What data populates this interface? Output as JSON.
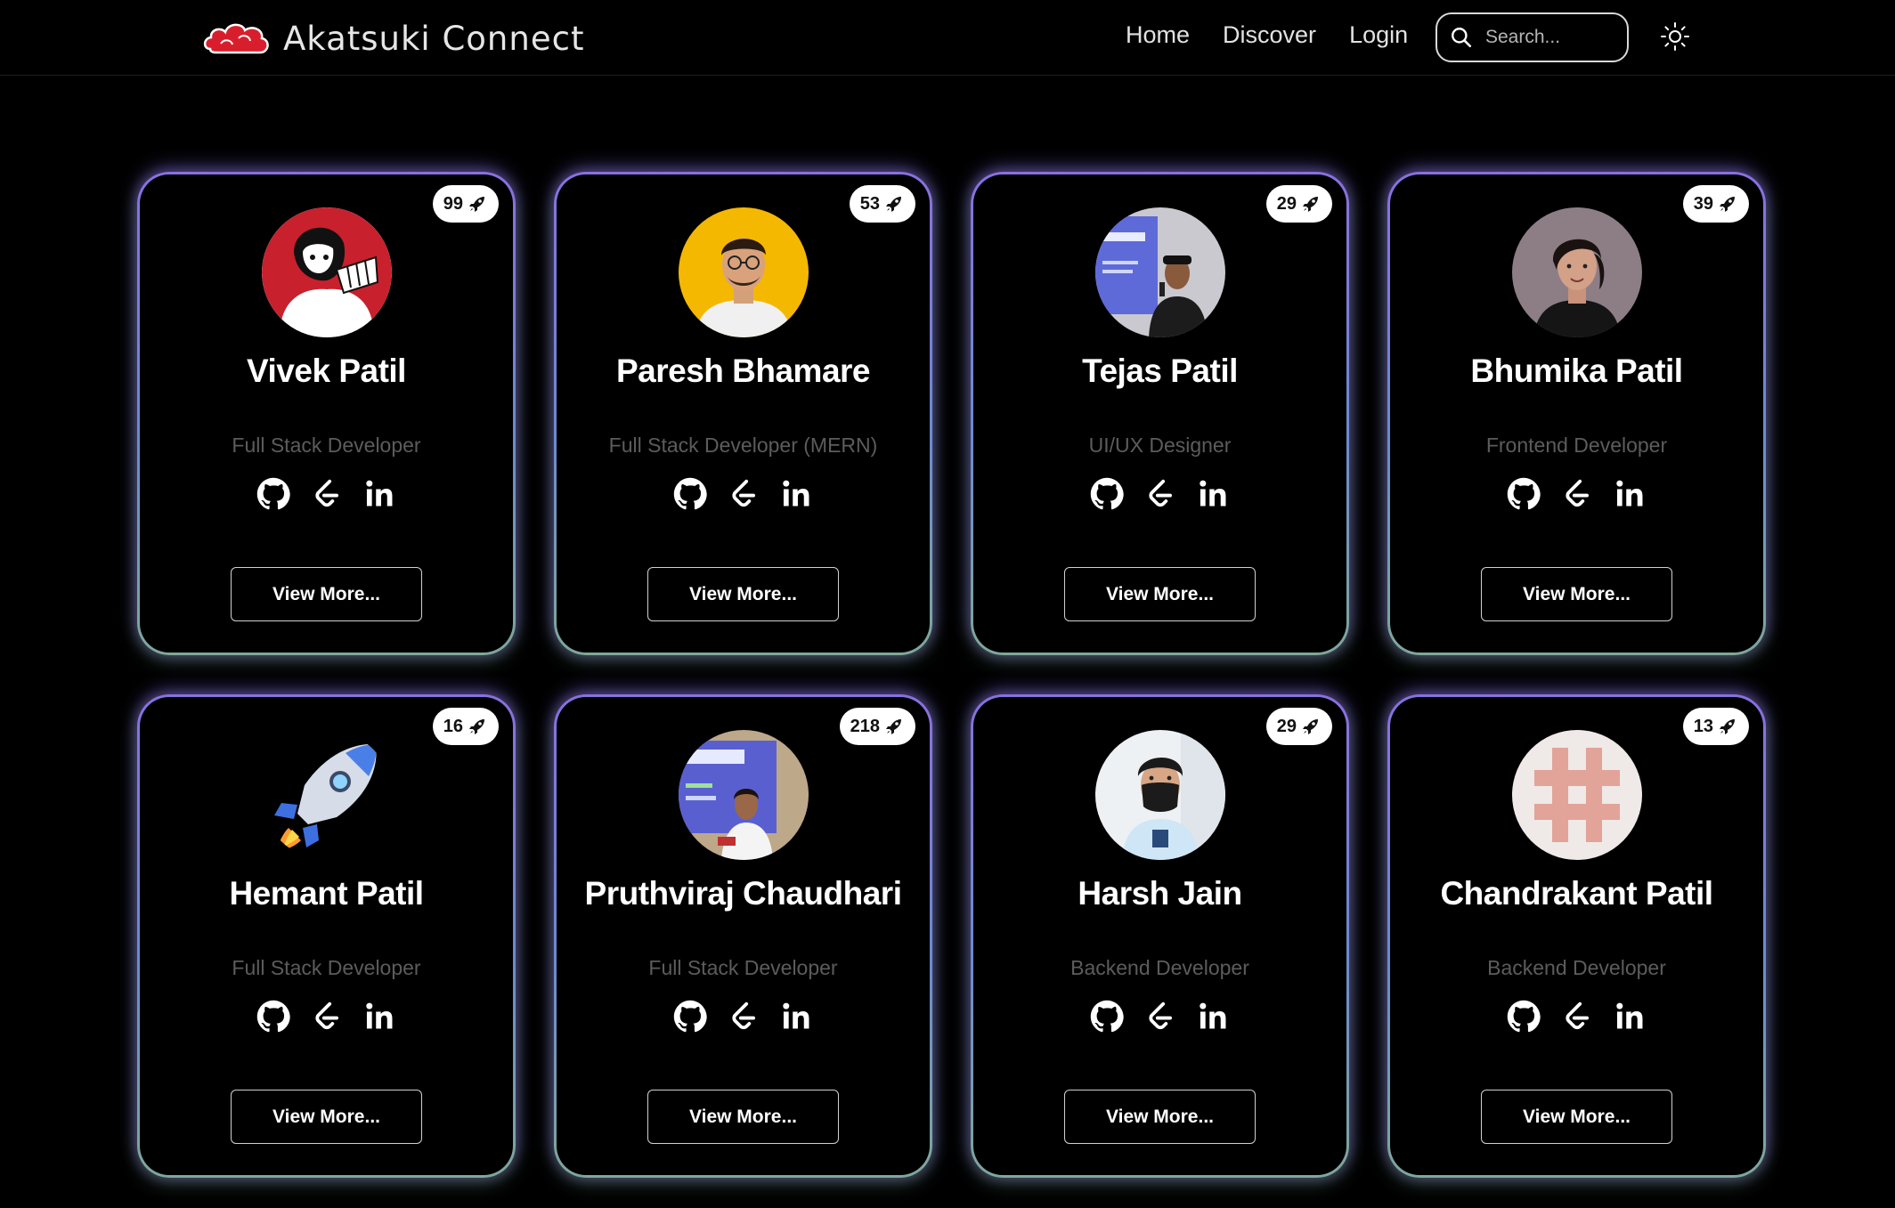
{
  "nav": {
    "brand": "Akatsuki Connect",
    "links": [
      "Home",
      "Discover",
      "Login"
    ],
    "search_placeholder": "Search..."
  },
  "icons": {
    "brand": "akatsuki-cloud-icon",
    "search": "search-icon",
    "theme": "sun-icon",
    "badge": "rocket-icon",
    "socials": [
      "github-icon",
      "leetcode-icon",
      "linkedin-icon"
    ]
  },
  "button_label": "View More...",
  "colors": {
    "background": "#000000",
    "card_border_top": "#8b6fe0",
    "card_border_bottom": "#7fa89a",
    "role_text": "#5c5c5c",
    "brand_red": "#d81e2c"
  },
  "profiles": [
    {
      "name": "Vivek Patil",
      "role": "Full Stack Developer",
      "count": "99",
      "avatar": "manga-character-avatar"
    },
    {
      "name": "Paresh Bhamare",
      "role": "Full Stack Developer (MERN)",
      "count": "53",
      "avatar": "photo-avatar"
    },
    {
      "name": "Tejas Patil",
      "role": "UI/UX Designer",
      "count": "29",
      "avatar": "photo-avatar"
    },
    {
      "name": "Bhumika Patil",
      "role": "Frontend Developer",
      "count": "39",
      "avatar": "photo-avatar"
    },
    {
      "name": "Hemant Patil",
      "role": "Full Stack Developer",
      "count": "16",
      "avatar": "rocket-emoji-avatar"
    },
    {
      "name": "Pruthviraj Chaudhari",
      "role": "Full Stack Developer",
      "count": "218",
      "avatar": "photo-avatar"
    },
    {
      "name": "Harsh Jain",
      "role": "Backend Developer",
      "count": "29",
      "avatar": "photo-avatar"
    },
    {
      "name": "Chandrakant Patil",
      "role": "Backend Developer",
      "count": "13",
      "avatar": "identicon-avatar"
    }
  ]
}
